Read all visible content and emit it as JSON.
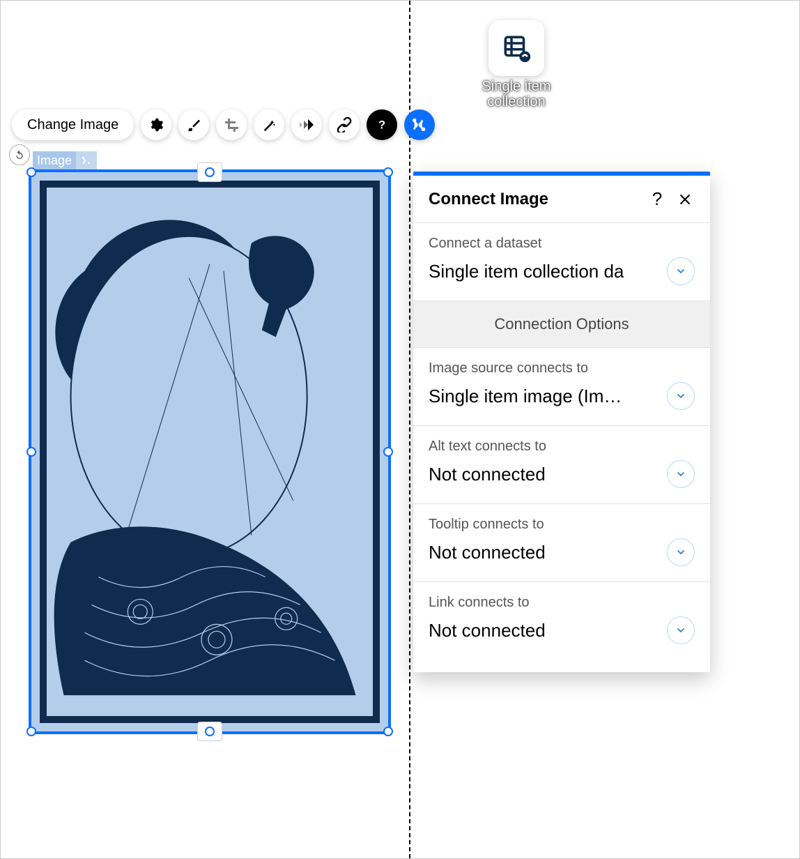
{
  "collection_button_label": "Single item collection",
  "toolbar": {
    "change_image": "Change Image"
  },
  "element_chip": "Image",
  "panel": {
    "title": "Connect Image",
    "dataset": {
      "label": "Connect a dataset",
      "value": "Single item collection da"
    },
    "options_heading": "Connection Options",
    "source": {
      "label": "Image source connects to",
      "value": "Single item image (Im…"
    },
    "alt": {
      "label": "Alt text connects to",
      "value": "Not connected"
    },
    "tooltip": {
      "label": "Tooltip connects to",
      "value": "Not connected"
    },
    "link": {
      "label": "Link connects to",
      "value": "Not connected"
    }
  }
}
